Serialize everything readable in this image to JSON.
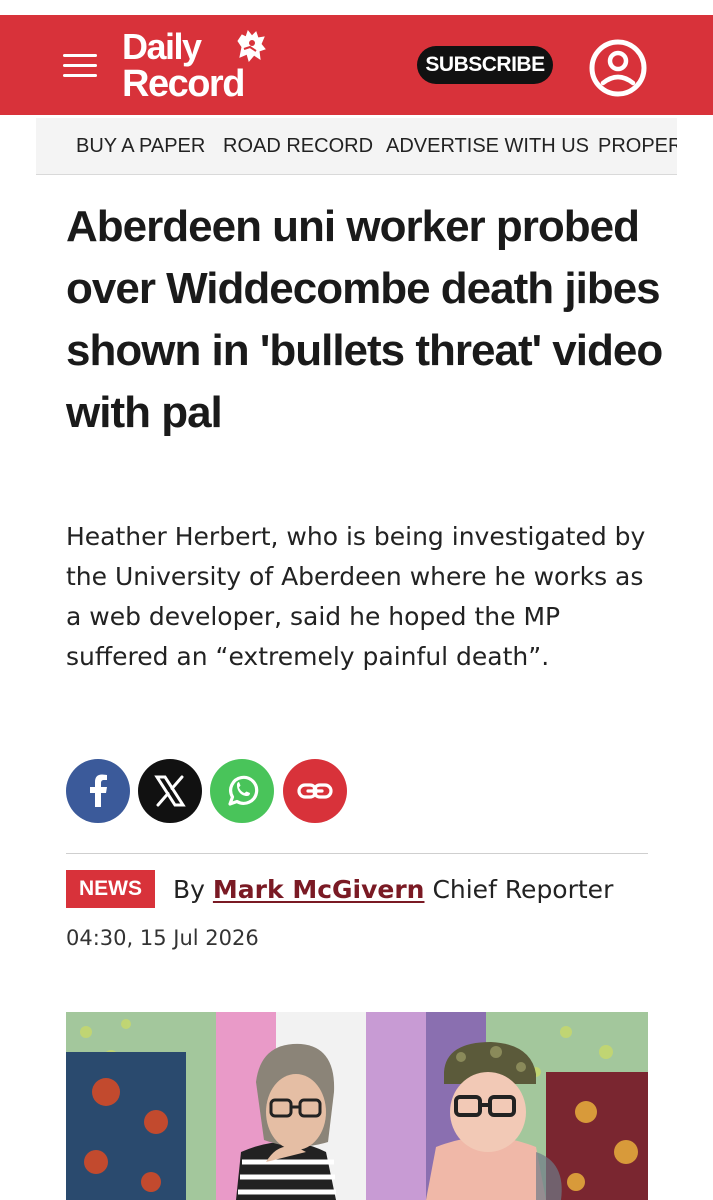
{
  "header": {
    "logo_line1": "Daily",
    "logo_line2": "Record",
    "subscribe_label": "SUBSCRIBE",
    "brand_color": "#d8323a",
    "menu_icon": "hamburger-menu-icon",
    "account_icon": "user-account-icon"
  },
  "nav": {
    "items": [
      {
        "label": "BUY A PAPER"
      },
      {
        "label": "ROAD RECORD"
      },
      {
        "label": "ADVERTISE WITH US"
      },
      {
        "label": "PROPERTY"
      }
    ]
  },
  "article": {
    "headline": "Aberdeen uni worker probed over Widdecombe death jibes shown in 'bullets threat' video with pal",
    "standfirst": "Heather Herbert, who is being investigated by the University of Aberdeen where he works as a web developer, said he hoped the MP suffered an “extremely painful death”.",
    "share": [
      {
        "icon": "facebook-icon",
        "color": "#3b5a9a"
      },
      {
        "icon": "x-icon",
        "color": "#111111"
      },
      {
        "icon": "whatsapp-icon",
        "color": "#49c45a"
      },
      {
        "icon": "link-icon",
        "color": "#d8323a"
      }
    ],
    "category": "NEWS",
    "by": "By",
    "author": "Mark McGivern",
    "author_role": "Chief Reporter",
    "timestamp": "04:30, 15 Jul 2026"
  }
}
